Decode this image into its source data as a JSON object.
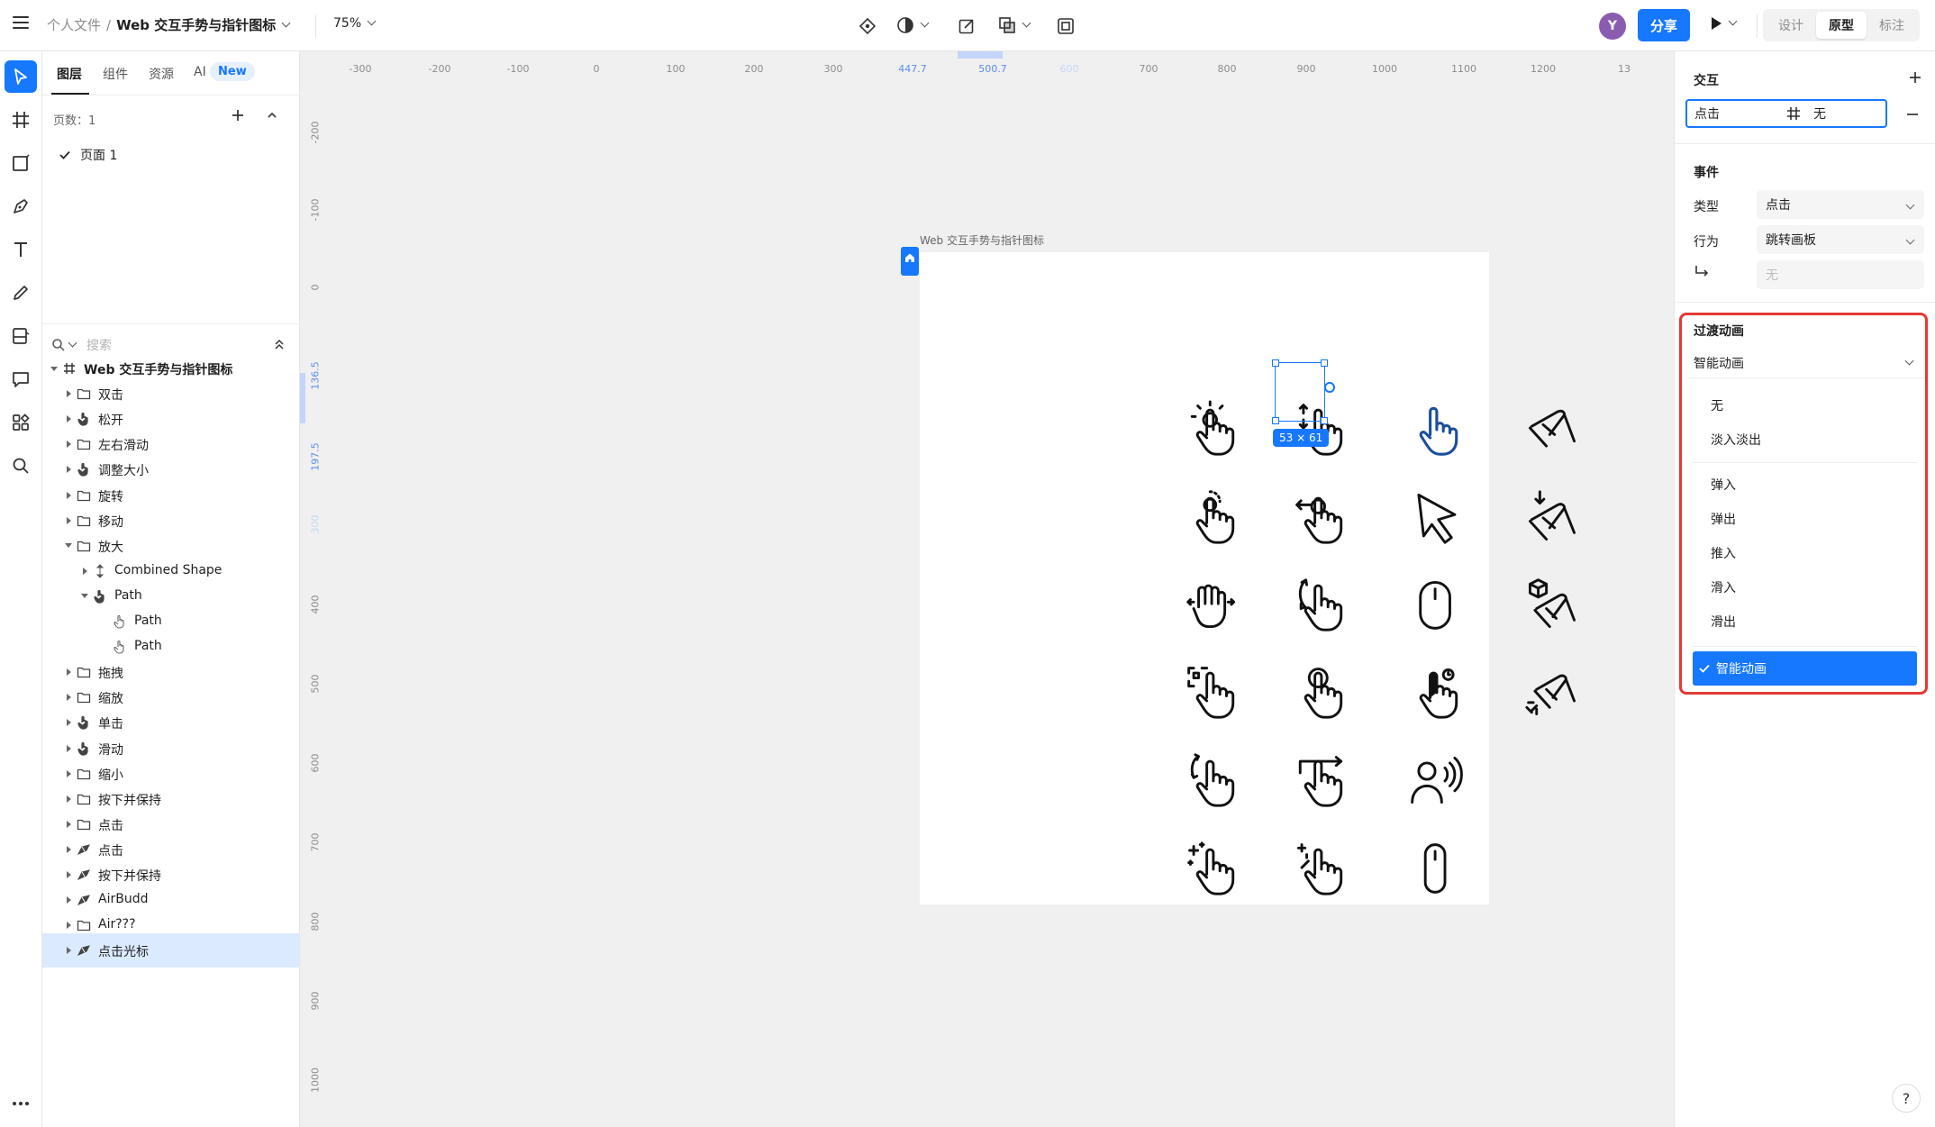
{
  "topbar": {
    "breadcrumb_parent": "个人文件",
    "breadcrumb_sep": "/",
    "file_name": "Web 交互手势与指针图标",
    "zoom": "75%",
    "avatar_initial": "Y",
    "share_label": "分享",
    "modes": [
      "设计",
      "原型",
      "标注"
    ],
    "active_mode": "原型"
  },
  "tools": [
    "move-tool",
    "frame-tool",
    "rectangle-tool",
    "pen-tool",
    "text-tool",
    "pencil-tool",
    "component-tool",
    "comment-tool",
    "plugins-tool",
    "search-tool",
    "more-tool"
  ],
  "layers_panel": {
    "tabs": [
      "图层",
      "组件",
      "资源",
      "AI"
    ],
    "ai_badge": "New",
    "pages_label": "页数：1",
    "pages": [
      {
        "label": "页面 1",
        "current": true
      }
    ],
    "search_placeholder": "搜索",
    "tree": [
      {
        "label": "Web 交互手势与指针图标",
        "depth": 0,
        "expanded": true,
        "icon": "frame-icon",
        "bold": true
      },
      {
        "label": "双击",
        "depth": 1,
        "icon": "folder-icon"
      },
      {
        "label": "松开",
        "depth": 1,
        "icon": "hand-icon"
      },
      {
        "label": "左右滑动",
        "depth": 1,
        "icon": "folder-icon"
      },
      {
        "label": "调整大小",
        "depth": 1,
        "icon": "hand-icon"
      },
      {
        "label": "旋转",
        "depth": 1,
        "icon": "folder-icon"
      },
      {
        "label": "移动",
        "depth": 1,
        "icon": "folder-icon"
      },
      {
        "label": "放大",
        "depth": 1,
        "expanded": true,
        "icon": "folder-icon"
      },
      {
        "label": "Combined Shape",
        "depth": 2,
        "icon": "combined-shape-icon"
      },
      {
        "label": "Path",
        "depth": 2,
        "expanded": true,
        "icon": "hand-icon"
      },
      {
        "label": "Path",
        "depth": 3,
        "leaf": true,
        "icon": "hand-outline-icon"
      },
      {
        "label": "Path",
        "depth": 3,
        "leaf": true,
        "icon": "hand-outline-icon"
      },
      {
        "label": "拖拽",
        "depth": 1,
        "icon": "folder-icon"
      },
      {
        "label": "缩放",
        "depth": 1,
        "icon": "folder-icon"
      },
      {
        "label": "单击",
        "depth": 1,
        "icon": "hand-icon"
      },
      {
        "label": "滑动",
        "depth": 1,
        "icon": "hand-icon"
      },
      {
        "label": "缩小",
        "depth": 1,
        "icon": "folder-icon"
      },
      {
        "label": "按下并保持",
        "depth": 1,
        "icon": "folder-icon"
      },
      {
        "label": "点击",
        "depth": 1,
        "icon": "folder-icon"
      },
      {
        "label": "点击",
        "depth": 1,
        "icon": "pen-hand-icon"
      },
      {
        "label": "按下并保持",
        "depth": 1,
        "icon": "pen-hand-icon"
      },
      {
        "label": "AirBudd",
        "depth": 1,
        "icon": "pen-hand-icon"
      },
      {
        "label": "Air???",
        "depth": 1,
        "icon": "folder-icon"
      },
      {
        "label": "点击光标",
        "depth": 1,
        "icon": "pen-hand-icon",
        "selected": true
      }
    ]
  },
  "canvas": {
    "ruler_h": [
      "-300",
      "-200",
      "-100",
      "0",
      "100",
      "200",
      "300",
      "447.7",
      "500.7",
      "600",
      "700",
      "800",
      "900",
      "1000",
      "1100",
      "1200",
      "13"
    ],
    "ruler_h_highlight": [
      "447.7",
      "500.7"
    ],
    "ruler_v": [
      "-200",
      "-100",
      "0",
      "136.5",
      "197.5",
      "300",
      "400",
      "500",
      "600",
      "700",
      "800",
      "900",
      "1000"
    ],
    "ruler_v_highlight": [
      "136.5",
      "197.5"
    ],
    "artboard_label": "Web 交互手势与指针图标",
    "selection_size": "53 × 61",
    "icons": [
      "tap-icon",
      "swipe-vertical-icon",
      "pointer-hand-icon",
      "pinch-icon",
      "double-tap-icon",
      "drag-left-icon",
      "cursor-arrow-icon",
      "pinch-in-icon",
      "hand-spread-icon",
      "rotate-icon",
      "mouse-icon",
      "pinch-3d-icon",
      "hand-frame-icon",
      "press-hold-icon",
      "tap-timer-icon",
      "pinch-expand-icon",
      "rotate-hand-icon",
      "swipe-right-icon",
      "voice-user-icon",
      "",
      "sparkle-hand-icon",
      "sparkle-tap-icon",
      "mouse-slim-icon",
      ""
    ]
  },
  "props": {
    "interaction_title": "交互",
    "trigger_label": "点击",
    "trigger_target": "无",
    "events_title": "事件",
    "type_label": "类型",
    "type_value": "点击",
    "action_label": "行为",
    "action_value": "跳转画板",
    "destination_value": "无",
    "transition_title": "过渡动画",
    "transition_value": "智能动画",
    "transition_options_group1": [
      "无",
      "淡入淡出"
    ],
    "transition_options_group2": [
      "弹入",
      "弹出",
      "推入",
      "滑入",
      "滑出"
    ],
    "transition_selected": "智能动画"
  },
  "help_label": "?",
  "colors": {
    "accent": "#1677ff",
    "highlight_box": "#e53935",
    "selected_row": "#dbeaff"
  }
}
